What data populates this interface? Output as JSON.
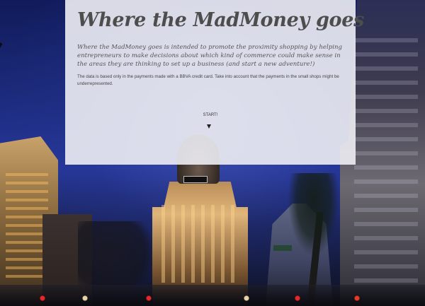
{
  "header": {
    "title": "Where the MadMoney goes"
  },
  "intro": {
    "tagline": "Where the MadMoney goes is intended to promote the proximity shopping by helping entrepreneurs to make decisions about which kind of commerce could make sense in the areas they are thinking to set up a business (and start a new adventure!)",
    "note": "The data is based only in the payments made with a BBVA credit card. Take into account that the payments in the small shops might be underrepresented."
  },
  "cta": {
    "start_label": "START!",
    "arrow_icon": "chevron-down-icon"
  },
  "colors": {
    "panel_background": "#eeeef4",
    "title_text": "#4d4d4d",
    "body_text": "#555555"
  }
}
